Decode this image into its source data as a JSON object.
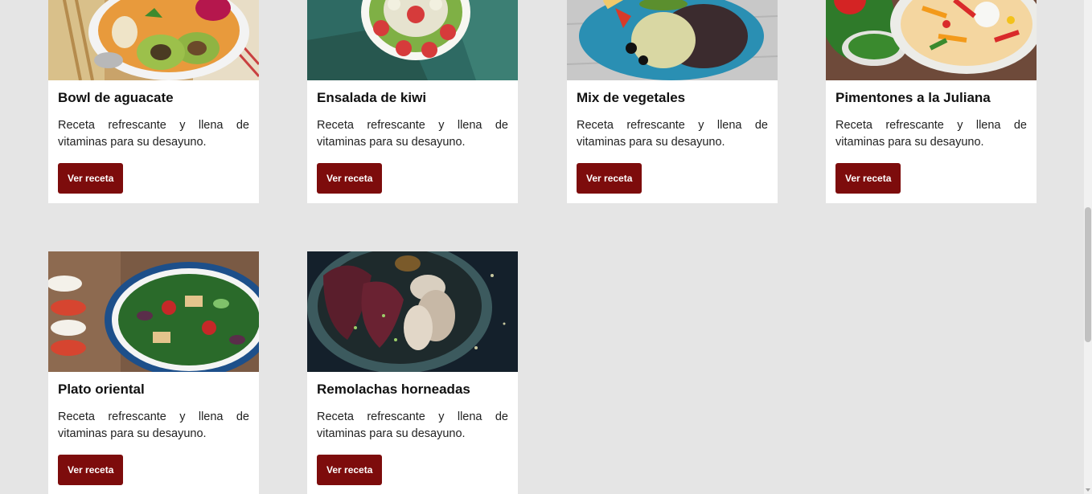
{
  "recipes": [
    {
      "title": "Bowl de aguacate",
      "description": "Receta refrescante y llena de vitaminas para su desayuno.",
      "button": "Ver receta",
      "image": "avocado-bowl-photo"
    },
    {
      "title": "Ensalada de kiwi",
      "description": "Receta refrescante y llena de vitaminas para su desayuno.",
      "button": "Ver receta",
      "image": "kiwi-salad-photo"
    },
    {
      "title": "Mix de vegetales",
      "description": "Receta refrescante y llena de vitaminas para su desayuno.",
      "button": "Ver receta",
      "image": "vegetable-mix-photo"
    },
    {
      "title": "Pimentones a la Juliana",
      "description": "Receta refrescante y llena de vitaminas para su desayuno.",
      "button": "Ver receta",
      "image": "peppers-julienne-photo"
    },
    {
      "title": "Plato oriental",
      "description": "Receta refrescante y llena de vitaminas para su desayuno.",
      "button": "Ver receta",
      "image": "oriental-plate-photo"
    },
    {
      "title": "Remolachas horneadas",
      "description": "Receta refrescante y llena de vitaminas para su desayuno.",
      "button": "Ver receta",
      "image": "baked-beets-photo"
    }
  ],
  "colors": {
    "background": "#e5e5e5",
    "card": "#ffffff",
    "button": "#7d0c0c",
    "button_text": "#ffffff"
  }
}
